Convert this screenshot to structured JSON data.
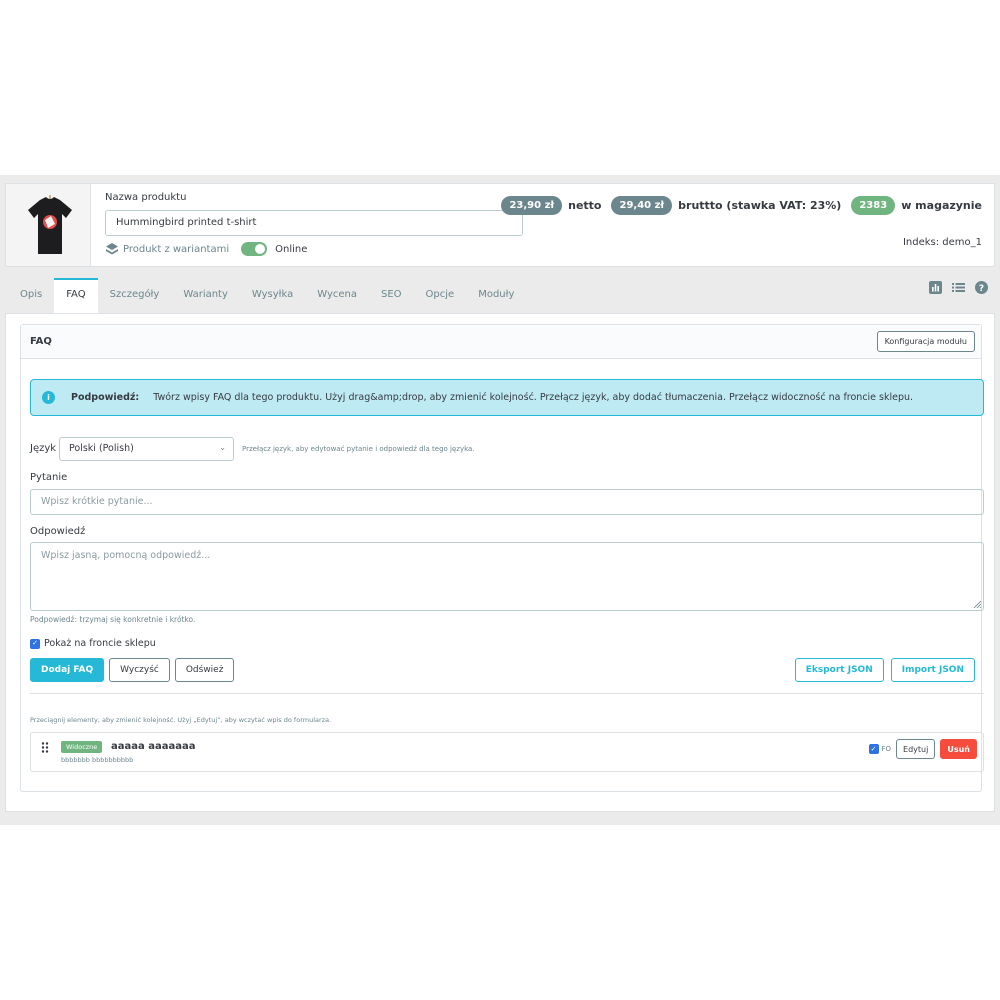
{
  "product": {
    "name_label": "Nazwa produktu",
    "name_value": "Hummingbird printed t-shirt",
    "variants_label": "Produkt z wariantami",
    "status_label": "Online",
    "status_on": true,
    "price_net": "23,90 zł",
    "net_label": "netto",
    "price_gross": "29,40 zł",
    "gross_label": "bruttto (stawka VAT: 23%)",
    "stock": "2383",
    "stock_label": "w magazynie",
    "index_label": "Indeks: demo_1"
  },
  "tabs": [
    {
      "label": "Opis",
      "active": false
    },
    {
      "label": "FAQ",
      "active": true
    },
    {
      "label": "Szczegóły",
      "active": false
    },
    {
      "label": "Warianty",
      "active": false
    },
    {
      "label": "Wysyłka",
      "active": false
    },
    {
      "label": "Wycena",
      "active": false
    },
    {
      "label": "SEO",
      "active": false
    },
    {
      "label": "Opcje",
      "active": false
    },
    {
      "label": "Moduły",
      "active": false
    }
  ],
  "toolbar_icons": [
    "bar-chart-icon",
    "list-icon",
    "help-icon"
  ],
  "faq_panel": {
    "title": "FAQ",
    "config_button": "Konfiguracja modułu",
    "alert_title": "Podpowiedź:",
    "alert_text": "Twórz wpisy FAQ dla tego produktu. Użyj drag&amp;drop, aby zmienić kolejność. Przełącz język, aby dodać tłumaczenia. Przełącz widoczność na froncie sklepu.",
    "language_label": "Język",
    "language_value": "Polski (Polish)",
    "language_hint": "Przełącz język, aby edytować pytanie i odpowiedź dla tego języka.",
    "question_label": "Pytanie",
    "question_placeholder": "Wpisz krótkie pytanie...",
    "answer_label": "Odpowiedź",
    "answer_placeholder": "Wpisz jasną, pomocną odpowiedź...",
    "answer_hint": "Podpowiedź: trzymaj się konkretnie i krótko.",
    "show_front_label": "Pokaż na froncie sklepu",
    "show_front_checked": true,
    "add_button": "Dodaj FAQ",
    "clear_button": "Wyczyść",
    "refresh_button": "Odśwież",
    "export_button": "Eksport JSON",
    "import_button": "Import JSON",
    "list_hint": "Przeciągnij elementy, aby zmienić kolejność. Użyj „Edytuj”, aby wczytać wpis do formularza.",
    "items": [
      {
        "badge": "Widoczne",
        "question": "aaaaa aaaaaaa",
        "answer": "bbbbbbb bbbbbbbbbb",
        "fo_label": "FO",
        "fo_checked": true,
        "edit_label": "Edytuj",
        "delete_label": "Usuń"
      }
    ]
  },
  "colors": {
    "accent": "#25b9d7",
    "success": "#70b580",
    "danger": "#f54c3e",
    "muted_pill": "#6c868e"
  }
}
